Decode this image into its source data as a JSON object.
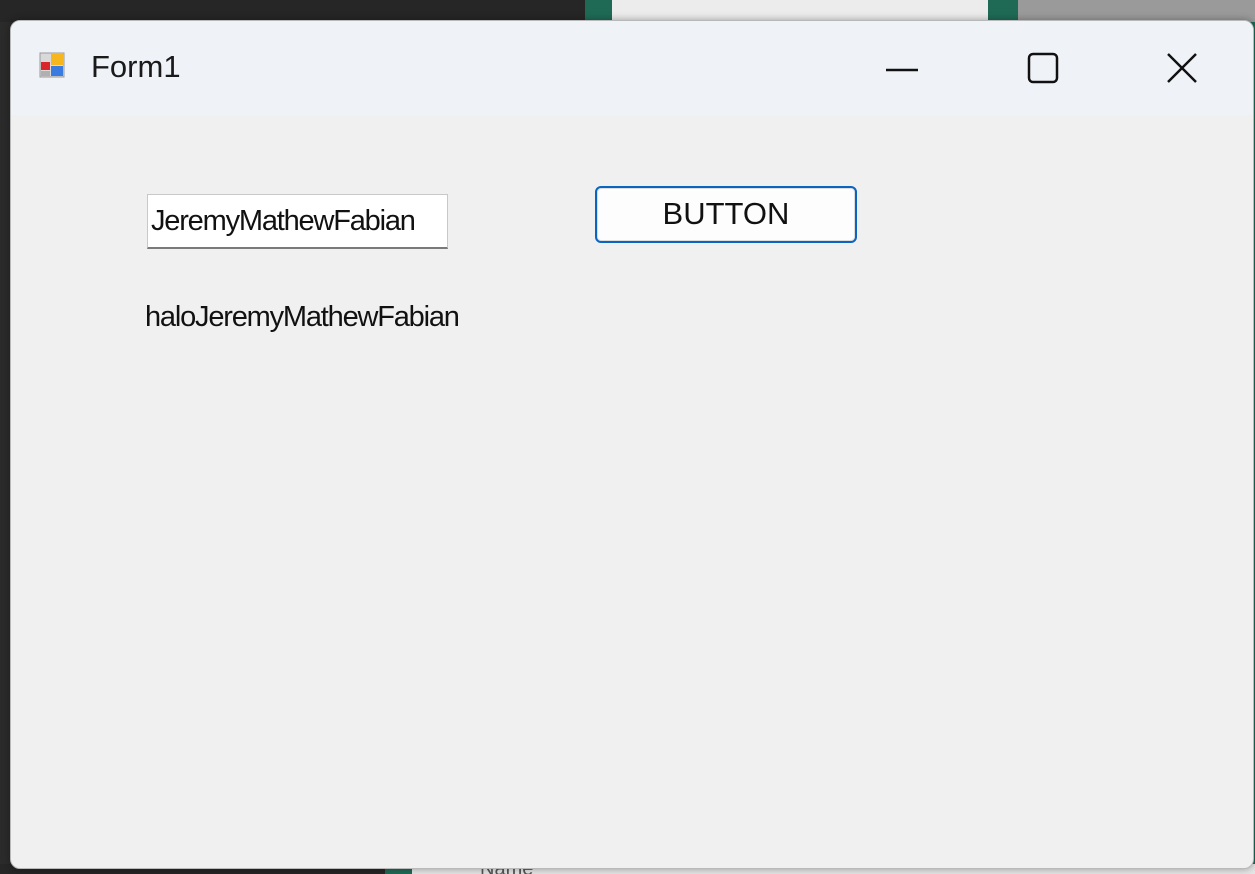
{
  "window": {
    "title": "Form1",
    "caption_buttons": {
      "minimize": "minimize-icon",
      "maximize": "maximize-icon",
      "close": "close-icon"
    }
  },
  "form": {
    "textbox_value": "JeremyMathewFabian",
    "button_label": "BUTTON",
    "label_text": "haloJeremyMathewFabian"
  },
  "background": {
    "partial_text": "Name"
  },
  "colors": {
    "button_focus_border": "#0a64c2",
    "titlebar": "#eff3f8",
    "client_area": "#f0f0f0"
  }
}
